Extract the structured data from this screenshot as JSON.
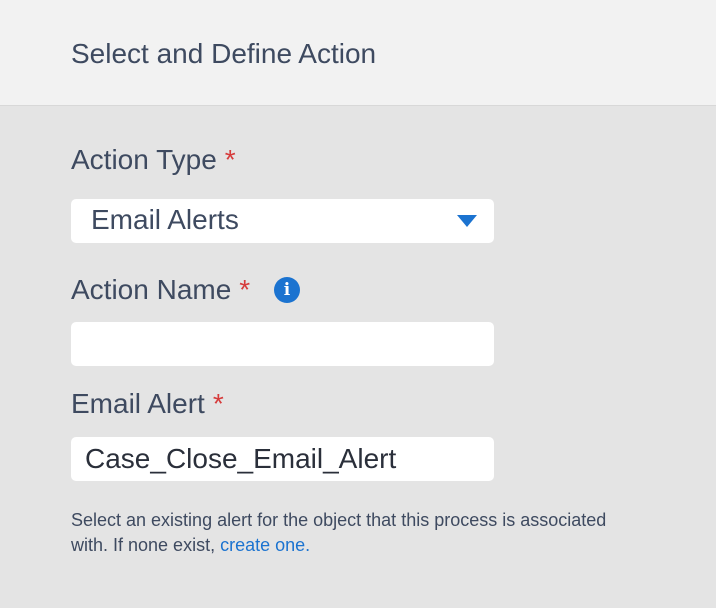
{
  "header": {
    "title": "Select and Define Action"
  },
  "form": {
    "action_type": {
      "label": "Action Type",
      "required_mark": "*",
      "selected": "Email Alerts"
    },
    "action_name": {
      "label": "Action Name",
      "required_mark": "*",
      "info_icon": "info-icon",
      "info_glyph": "i",
      "value": ""
    },
    "email_alert": {
      "label": "Email Alert",
      "required_mark": "*",
      "value": "Case_Close_Email_Alert"
    },
    "help": {
      "text": "Select an existing alert for the object that this process is associated with. If none exist,",
      "link_text": "create one."
    }
  },
  "colors": {
    "accent": "#1b73d0",
    "required": "#d63b3b",
    "header_bg": "#f2f2f2",
    "panel_bg": "#e4e4e4",
    "text": "#3e4a60"
  }
}
